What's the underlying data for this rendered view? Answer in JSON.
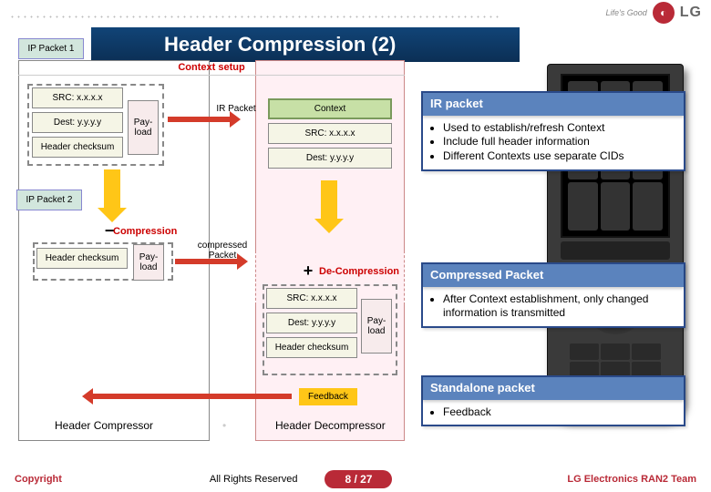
{
  "header": {
    "tagline": "Life's Good",
    "logo_letters": "LG",
    "title": "Header Compression (2)"
  },
  "phases": {
    "context_setup": "Context setup",
    "compression": "Compression",
    "decompression": "De-Compression"
  },
  "packet_labels": {
    "ip_packet_1": "IP Packet 1",
    "ip_packet_2": "IP Packet 2",
    "ir_packet": "IR Packet",
    "compressed_packet": "compressed Packet",
    "context": "Context"
  },
  "fields": {
    "src": "SRC: x.x.x.x",
    "dest": "Dest: y.y.y.y",
    "header_checksum": "Header checksum",
    "payload": "Pay-\nload"
  },
  "callouts": {
    "ir_title": "IR packet",
    "ir_b1": "Used to establish/refresh Context",
    "ir_b2": "Include full header information",
    "ir_b3": "Different Contexts use separate CIDs",
    "cp_title": "Compressed Packet",
    "cp_b1": "After Context establishment, only changed information is transmitted",
    "sp_title": "Standalone packet",
    "sp_b1": "Feedback"
  },
  "labels": {
    "feedback": "Feedback",
    "header_compressor": "Header Compressor",
    "header_decompressor": "Header Decompressor"
  },
  "footer": {
    "copyright": "Copyright",
    "rights": "All Rights Reserved",
    "page": "8 / 27",
    "team": "LG Electronics RAN2 Team"
  },
  "colors": {
    "brand_red": "#b92a37"
  }
}
